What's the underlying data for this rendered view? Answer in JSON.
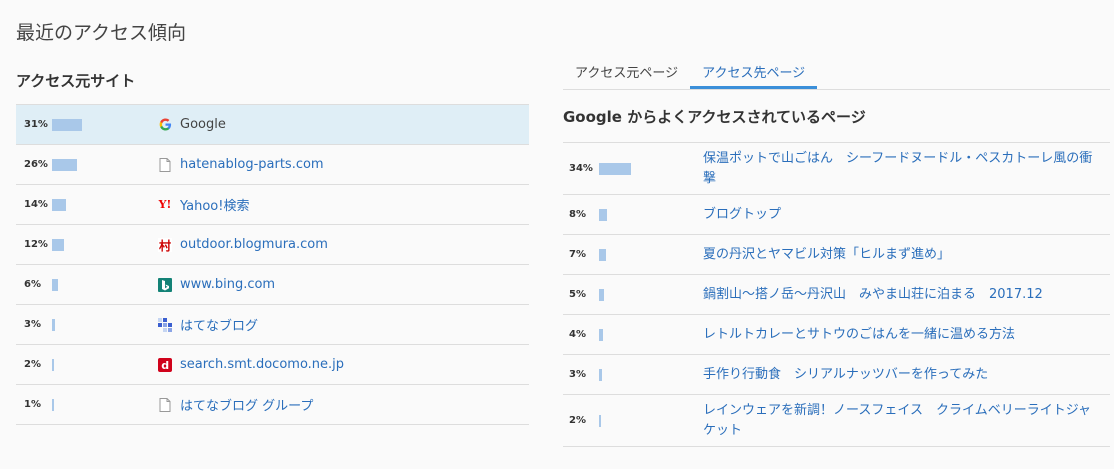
{
  "page_title": "最近のアクセス傾向",
  "sources": {
    "title": "アクセス元サイト",
    "items": [
      {
        "pct": "31%",
        "value": 31,
        "icon": "google-icon",
        "name": "Google",
        "link": false
      },
      {
        "pct": "26%",
        "value": 26,
        "icon": "document-icon",
        "name": "hatenablog-parts.com",
        "link": true
      },
      {
        "pct": "14%",
        "value": 14,
        "icon": "yahoo-icon",
        "name": "Yahoo!検索",
        "link": true
      },
      {
        "pct": "12%",
        "value": 12,
        "icon": "blogmura-icon",
        "name": "outdoor.blogmura.com",
        "link": true
      },
      {
        "pct": "6%",
        "value": 6,
        "icon": "bing-icon",
        "name": "www.bing.com",
        "link": true
      },
      {
        "pct": "3%",
        "value": 3,
        "icon": "hatena-icon",
        "name": "はてなブログ",
        "link": true
      },
      {
        "pct": "2%",
        "value": 2,
        "icon": "docomo-icon",
        "name": "search.smt.docomo.ne.jp",
        "link": true
      },
      {
        "pct": "1%",
        "value": 1,
        "icon": "document-icon",
        "name": "はてなブログ グループ",
        "link": true
      }
    ]
  },
  "tabs": [
    {
      "label": "アクセス元ページ",
      "active": false
    },
    {
      "label": "アクセス先ページ",
      "active": true
    }
  ],
  "destinations": {
    "title": "Google からよくアクセスされているページ",
    "items": [
      {
        "pct": "34%",
        "value": 34,
        "title": "保温ポットで山ごはん　シーフードヌードル・ペスカトーレ風の衝撃"
      },
      {
        "pct": "8%",
        "value": 8,
        "title": "ブログトップ"
      },
      {
        "pct": "7%",
        "value": 7,
        "title": "夏の丹沢とヤマビル対策「ヒルまず進め」"
      },
      {
        "pct": "5%",
        "value": 5,
        "title": "鍋割山～搭ノ岳～丹沢山　みやま山荘に泊まる　2017.12"
      },
      {
        "pct": "4%",
        "value": 4,
        "title": "レトルトカレーとサトウのごはんを一緒に温める方法"
      },
      {
        "pct": "3%",
        "value": 3,
        "title": "手作り行動食　シリアルナッツバーを作ってみた"
      },
      {
        "pct": "2%",
        "value": 2,
        "title": "レインウェアを新調！ノースフェイス　クライムベリーライトジャケット"
      }
    ]
  },
  "colors": {
    "bar": "#a9c8e9",
    "link": "#2a6ebb",
    "highlight": "#dfeef6"
  }
}
